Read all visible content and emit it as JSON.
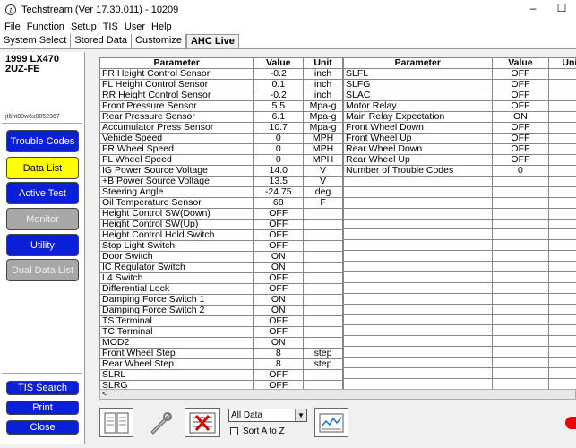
{
  "titlebar": {
    "icon_glyph": "t",
    "title": "Techstream (Ver 17.30.011) - 10209",
    "minimize": "–",
    "maximize": "☐"
  },
  "menu": [
    "File",
    "Function",
    "Setup",
    "TIS",
    "User",
    "Help"
  ],
  "tabs": [
    "System Select",
    "Stored Data",
    "Customize",
    "AHC Live"
  ],
  "active_tab": "AHC Live",
  "vehicle": {
    "model": "1999 LX470",
    "engine": "2UZ-FE",
    "vin": "jt6ht00w6x0052367"
  },
  "nav": {
    "trouble_codes": "Trouble Codes",
    "data_list": "Data List",
    "active_test": "Active Test",
    "monitor": "Monitor",
    "utility": "Utility",
    "dual_data_list": "Dual Data List",
    "tis_search": "TIS Search",
    "print": "Print",
    "close": "Close"
  },
  "table_headers": {
    "parameter": "Parameter",
    "value": "Value",
    "unit": "Unit"
  },
  "left_rows": [
    [
      "FR Height Control Sensor",
      "-0.2",
      "inch"
    ],
    [
      "FL Height Control Sensor",
      "0.1",
      "inch"
    ],
    [
      "RR Height Control Sensor",
      "-0.2",
      "inch"
    ],
    [
      "Front Pressure Sensor",
      "5.5",
      "Mpa-g"
    ],
    [
      "Rear Pressure Sensor",
      "6.1",
      "Mpa-g"
    ],
    [
      "Accumulator Press Sensor",
      "10.7",
      "Mpa-g"
    ],
    [
      "Vehicle Speed",
      "0",
      "MPH"
    ],
    [
      "FR Wheel Speed",
      "0",
      "MPH"
    ],
    [
      "FL Wheel Speed",
      "0",
      "MPH"
    ],
    [
      "IG Power Source Voltage",
      "14.0",
      "V"
    ],
    [
      "+B Power Source Voltage",
      "13.5",
      "V"
    ],
    [
      "Steering Angle",
      "-24.75",
      "deg"
    ],
    [
      "Oil Temperature Sensor",
      "68",
      "F"
    ],
    [
      "Height Control SW(Down)",
      "OFF",
      ""
    ],
    [
      "Height Control SW(Up)",
      "OFF",
      ""
    ],
    [
      "Height Control Hold Switch",
      "OFF",
      ""
    ],
    [
      "Stop Light Switch",
      "OFF",
      ""
    ],
    [
      "Door Switch",
      "ON",
      ""
    ],
    [
      "IC Regulator Switch",
      "ON",
      ""
    ],
    [
      "L4 Switch",
      "OFF",
      ""
    ],
    [
      "Differential Lock",
      "OFF",
      ""
    ],
    [
      "Damping Force Switch 1",
      "ON",
      ""
    ],
    [
      "Damping Force Switch 2",
      "ON",
      ""
    ],
    [
      "TS Terminal",
      "OFF",
      ""
    ],
    [
      "TC Terminal",
      "OFF",
      ""
    ],
    [
      "MOD2",
      "ON",
      ""
    ],
    [
      "Front Wheel Step",
      "8",
      "step"
    ],
    [
      "Rear Wheel Step",
      "8",
      "step"
    ],
    [
      "SLRL",
      "OFF",
      ""
    ],
    [
      "SLRG",
      "OFF",
      ""
    ]
  ],
  "right_rows": [
    [
      "SLFL",
      "OFF",
      ""
    ],
    [
      "SLFG",
      "OFF",
      ""
    ],
    [
      "SLAC",
      "OFF",
      ""
    ],
    [
      "Motor Relay",
      "OFF",
      ""
    ],
    [
      "Main Relay Expectation",
      "ON",
      ""
    ],
    [
      "Front Wheel Down",
      "OFF",
      ""
    ],
    [
      "Front Wheel Up",
      "OFF",
      ""
    ],
    [
      "Rear Wheel Down",
      "OFF",
      ""
    ],
    [
      "Rear Wheel Up",
      "OFF",
      ""
    ],
    [
      "Number of Trouble Codes",
      "0",
      ""
    ]
  ],
  "filter": {
    "selected": "All Data",
    "sort_label": "Sort A to Z"
  },
  "scroll_arrow": "<",
  "dropdown_arrow": "▼"
}
